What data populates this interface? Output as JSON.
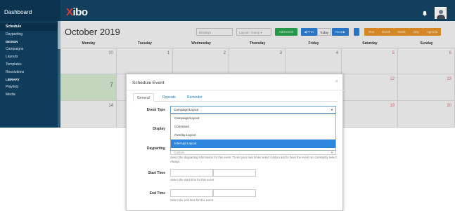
{
  "sidebar": {
    "brand": "Dashboard",
    "items": [
      {
        "label": "Schedule",
        "active": true
      },
      {
        "label": "Dayparting"
      }
    ],
    "sections": [
      {
        "title": "DESIGN",
        "items": [
          "Campaigns",
          "Layouts",
          "Templates",
          "Resolutions"
        ]
      },
      {
        "title": "LIBRARY",
        "items": [
          "Playlists",
          "Media"
        ]
      }
    ]
  },
  "topbar": {
    "logo_x": "X",
    "logo_rest": "ibo"
  },
  "calendar": {
    "title": "October 2019",
    "displays_placeholder": "Displays",
    "layout_filter": "Layout / Camp",
    "add_event": "Add Event",
    "prev": "◀ Prev",
    "today": "Today",
    "next": "Next ▶",
    "views": [
      "Year",
      "Month",
      "Week",
      "Day",
      "Agenda"
    ],
    "days": [
      "Monday",
      "Tuesday",
      "Wednesday",
      "Thursday",
      "Friday",
      "Saturday",
      "Sunday"
    ],
    "week1": [
      "30",
      "1",
      "2",
      "3",
      "4",
      "5",
      "6"
    ],
    "week2": [
      "7",
      "",
      "",
      "",
      "",
      "12",
      "13"
    ],
    "week3": [
      "14",
      "",
      "",
      "",
      "",
      "19",
      "20"
    ],
    "colors": {
      "add": "#2dad55",
      "nav": "#2f86de",
      "view": "#f39a2b",
      "today_cell": "#dff5d9"
    }
  },
  "modal": {
    "title": "Schedule Event",
    "close": "×",
    "tabs": [
      "General",
      "Repeats",
      "Reminder"
    ],
    "event_type_label": "Event Type",
    "event_type_value": "Campaign/Layout",
    "options": [
      "Campaign/Layout",
      "Command",
      "Overlay Layout",
      "Interrupt Layout"
    ],
    "highlighted_option": "Interrupt Layout",
    "display_label": "Display",
    "dayparting_label": "Dayparting",
    "dayparting_value": "Custom",
    "dayparting_help": "Select the dayparting information for this event. To set your own times select custom and to have the event run constantly select Always.",
    "start_label": "Start Time",
    "start_help": "Select the start time for this event",
    "end_label": "End Time",
    "end_help": "Select the end time for this event"
  }
}
